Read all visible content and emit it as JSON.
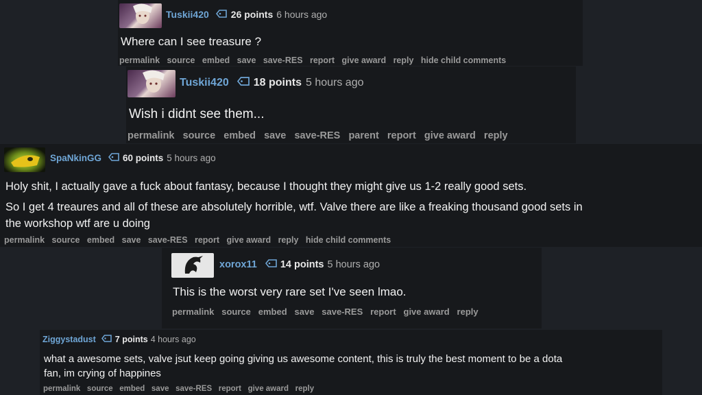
{
  "comments": [
    {
      "username": "Tuskii420",
      "points": "26 points",
      "time": "6 hours ago",
      "text": [
        "Where can I see treasure ?"
      ],
      "actions": [
        "permalink",
        "source",
        "embed",
        "save",
        "save-RES",
        "report",
        "give award",
        "reply",
        "hide child comments"
      ],
      "avatar": "purple-haired-hero-avatar"
    },
    {
      "username": "Tuskii420",
      "points": "18 points",
      "time": "5 hours ago",
      "text": [
        "Wish i didnt see them..."
      ],
      "actions": [
        "permalink",
        "source",
        "embed",
        "save",
        "save-RES",
        "parent",
        "report",
        "give award",
        "reply"
      ],
      "avatar": "purple-haired-hero-avatar"
    },
    {
      "username": "SpaNkinGG",
      "points": "60 points",
      "time": "5 hours ago",
      "text": [
        "Holy shit, I actually gave a fuck about fantasy, because I thought they might give us 1-2 really good sets.",
        "So I get 4 treaures and all of these are absolutely horrible, wtf. Valve there are like a freaking thousand good sets in",
        "the workshop wtf are u doing"
      ],
      "actions": [
        "permalink",
        "source",
        "embed",
        "save",
        "save-RES",
        "report",
        "give award",
        "reply",
        "hide child comments"
      ],
      "avatar": "green-yellow-creature-avatar"
    },
    {
      "username": "xorox11",
      "points": "14 points",
      "time": "5 hours ago",
      "text": [
        "This is the worst very rare set I've seen lmao."
      ],
      "actions": [
        "permalink",
        "source",
        "embed",
        "save",
        "save-RES",
        "report",
        "give award",
        "reply"
      ],
      "avatar": "dark-dragon-avatar"
    },
    {
      "username": "Ziggystadust",
      "points": "7 points",
      "time": "4 hours ago",
      "text": [
        "what a awesome sets, valve jsut keep going giving us awesome content, this is truly the best moment to be a dota",
        "fan, im crying of happines"
      ],
      "actions": [
        "permalink",
        "source",
        "embed",
        "save",
        "save-RES",
        "report",
        "give award",
        "reply"
      ],
      "avatar": ""
    }
  ],
  "colors": {
    "background": "#1e2126",
    "panel": "#17191c",
    "username": "#6fa6d6",
    "text": "#f2f2f2",
    "links": "#9a9a9a"
  }
}
